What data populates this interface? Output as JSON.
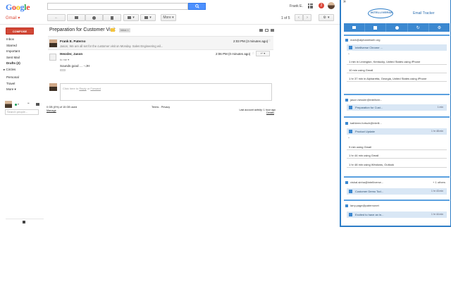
{
  "gmail": {
    "logo_letters": [
      "G",
      "o",
      "o",
      "g",
      "l",
      "e"
    ],
    "logo_colors": [
      "#4285f4",
      "#ea4335",
      "#fbbc05",
      "#4285f4",
      "#34a853",
      "#ea4335"
    ],
    "app_label": "Gmail ▾",
    "user_name": "Frank E.",
    "notification_count": "2",
    "more_button": "More ▾",
    "page_count": "1 of 5",
    "compose_label": "COMPOSE",
    "nav": [
      "Inbox",
      "Starred",
      "Important",
      "Sent Mail",
      "Drafts (2)",
      "Circles"
    ],
    "nav2": [
      "Personal",
      "Travel",
      "More ▾"
    ],
    "people_search_placeholder": "Search people...",
    "thread": {
      "subject": "Preparation for Customer Visit",
      "label": "Inbox ×",
      "msg1_from": "Frank E. Paterno",
      "msg1_snippet": "Jason, We are all set for the customer visit on Monday. Sales Engineering wil...",
      "msg1_time": "2:03 PM (3 minutes ago)",
      "msg2_from": "Hessler, Jason",
      "msg2_to": "to me ▾",
      "msg2_time": "2:06 PM (0 minutes ago)",
      "msg2_body": "Sounds good … --JH",
      "reply_prompt_pre": "Click here to ",
      "reply_link": "Reply",
      "reply_or": " or ",
      "forward_link": "Forward"
    },
    "footer": {
      "storage": "0 GB (0%) of 15 GB used",
      "manage": "Manage",
      "terms": "Terms - Privacy",
      "activity": "Last account activity: 1 hour ago",
      "details": "Details"
    }
  },
  "tracker": {
    "collapse_glyph": "»",
    "brand": "INTELLIVERSE",
    "title": "Email Tracker",
    "cards": [
      {
        "email": "mark@alphanetweb.org",
        "subject": "Intelliverse Chrome ...",
        "ago": "",
        "details": [
          "1 min in Lexington, Kentucky, United States using iPhone",
          "10 min using Gmail",
          "1 hr 37 min in Alpharetta, Georgia, United States using iPhone"
        ]
      },
      {
        "email": "jason.hessler@intelliver...",
        "subject": "Preparation for Cust...",
        "ago": "1 min",
        "details": []
      },
      {
        "email": "kathleen.fortsch@intelli...",
        "subject": "Product Update",
        "ago": "1 hr 48 min",
        "details": [
          "9 min using Gmail",
          "1 hr 44 min using Gmail",
          "1 hr 48 min using Windows, Outlook"
        ]
      },
      {
        "email": "vishal.sinha@intelliverse...",
        "subject": "Customer Demo Tod...",
        "ago": "1 hr 43 min",
        "more": "+ 1 others",
        "details": []
      },
      {
        "email": "larry.page@paternonet",
        "subject": "Excited to have an in...",
        "ago": "1 hr 44 min",
        "details": []
      }
    ]
  }
}
